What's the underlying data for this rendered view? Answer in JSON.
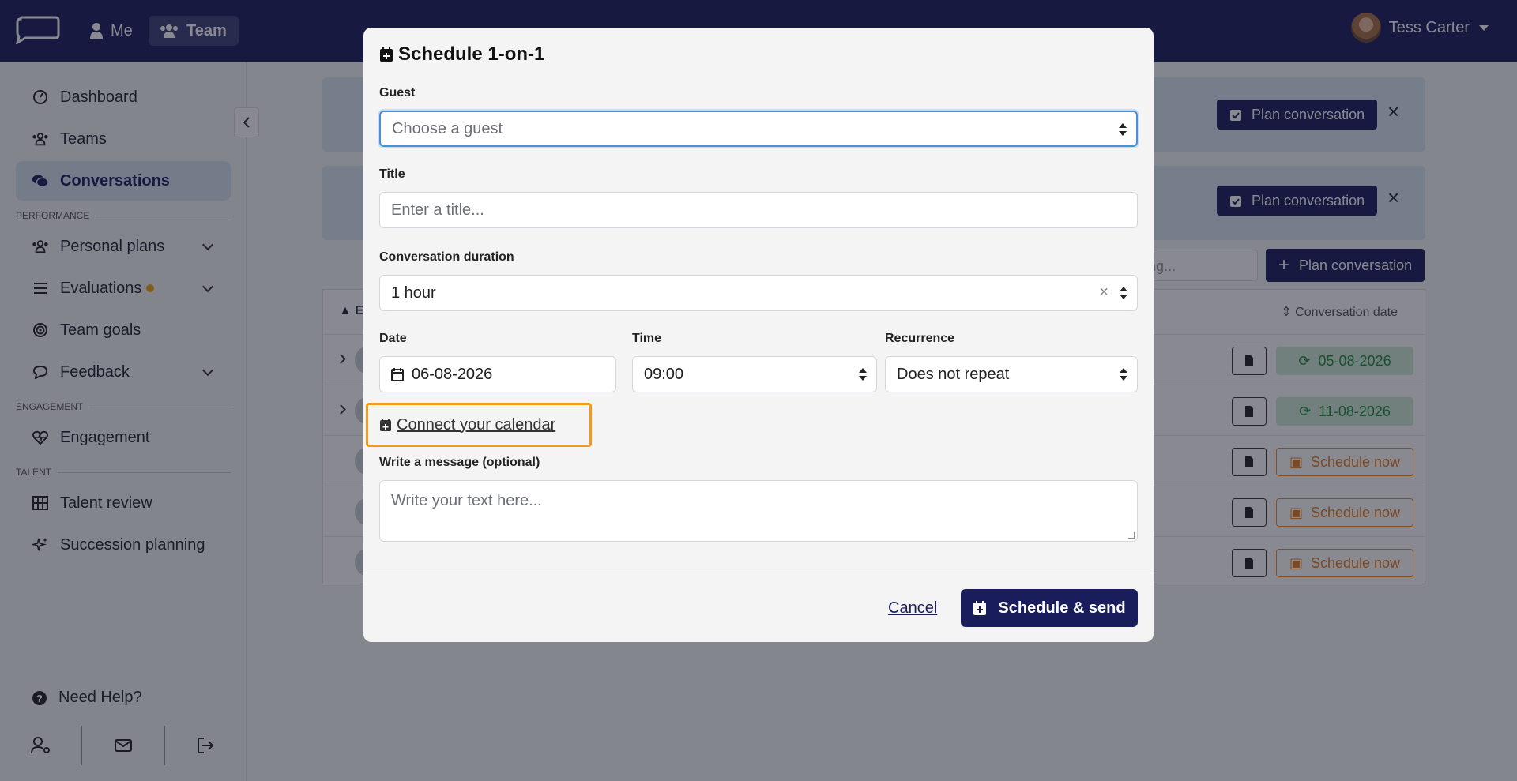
{
  "topbar": {
    "nav_me": "Me",
    "nav_team": "Team",
    "user_name": "Tess Carter"
  },
  "sidebar": {
    "items": [
      {
        "label": "Dashboard",
        "icon": "gauge-icon"
      },
      {
        "label": "Teams",
        "icon": "users-icon"
      },
      {
        "label": "Conversations",
        "icon": "comments-icon"
      },
      {
        "label": "Personal plans",
        "icon": "users-icon"
      },
      {
        "label": "Evaluations",
        "icon": "list-icon"
      },
      {
        "label": "Team goals",
        "icon": "target-icon"
      },
      {
        "label": "Feedback",
        "icon": "comment-icon"
      },
      {
        "label": "Engagement",
        "icon": "heart-pulse-icon"
      },
      {
        "label": "Talent review",
        "icon": "grid-icon"
      },
      {
        "label": "Succession planning",
        "icon": "sparkles-icon"
      }
    ],
    "sections": {
      "performance": "PERFORMANCE",
      "engagement": "ENGAGEMENT",
      "talent": "TALENT"
    },
    "help": "Need Help?"
  },
  "main": {
    "plan_conversation": "Plan conversation",
    "search_placeholder": "ing...",
    "column_date": "Conversation date",
    "column_first_fragment": "E",
    "rows": [
      {
        "date": "05-08-2026",
        "status": "scheduled"
      },
      {
        "date": "11-08-2026",
        "status": "scheduled"
      },
      {
        "action": "Schedule now",
        "status": "unscheduled"
      },
      {
        "action": "Schedule now",
        "status": "unscheduled"
      },
      {
        "action": "Schedule now",
        "status": "unscheduled"
      }
    ]
  },
  "modal": {
    "title": "Schedule 1-on-1",
    "guest_label": "Guest",
    "guest_placeholder": "Choose a guest",
    "title_label": "Title",
    "title_placeholder": "Enter a title...",
    "duration_label": "Conversation duration",
    "duration_value": "1 hour",
    "date_label": "Date",
    "date_value": "06-08-2026",
    "time_label": "Time",
    "time_value": "09:00",
    "recurrence_label": "Recurrence",
    "recurrence_value": "Does not repeat",
    "connect_calendar": "Connect your calendar",
    "message_label": "Write a message (optional)",
    "message_placeholder": "Write your text here...",
    "cancel": "Cancel",
    "submit": "Schedule & send"
  },
  "colors": {
    "brand": "#1a1d5c",
    "accent_orange": "#f29a1c",
    "success_green": "#1f8a3c",
    "focus_blue": "#4a90d9"
  }
}
